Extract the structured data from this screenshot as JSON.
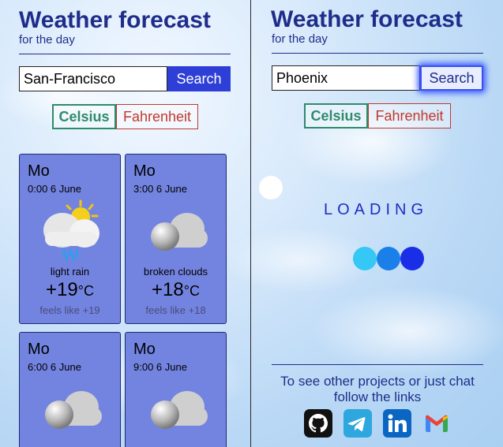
{
  "left": {
    "title": "Weather forecast",
    "subtitle": "for the day",
    "search_value": "San-Francisco",
    "search_button": "Search",
    "unit_celsius": "Celsius",
    "unit_fahrenheit": "Fahrenheit",
    "cards": [
      {
        "day": "Mo",
        "time": "0:00 6 June",
        "description": "light rain",
        "temp": "+19",
        "unit": "°C",
        "feels": "feels like +19",
        "icon": "sun-cloud-rain-icon"
      },
      {
        "day": "Mo",
        "time": "3:00 6 June",
        "description": "broken clouds",
        "temp": "+18",
        "unit": "°C",
        "feels": "feels like +18",
        "icon": "broken-clouds-icon"
      },
      {
        "day": "Mo",
        "time": "6:00 6 June",
        "icon": "broken-clouds-icon"
      },
      {
        "day": "Mo",
        "time": "9:00 6 June",
        "icon": "broken-clouds-icon"
      }
    ]
  },
  "right": {
    "title": "Weather forecast",
    "subtitle": "for the day",
    "search_value": "Phoenix",
    "search_button": "Search",
    "unit_celsius": "Celsius",
    "unit_fahrenheit": "Fahrenheit",
    "loading_text": "LOADING",
    "footer_text": "To see other projects or just chat follow the links",
    "social_icons": [
      "github-icon",
      "telegram-icon",
      "linkedin-icon",
      "gmail-icon"
    ],
    "colors": {
      "dot1": "#35c8f5",
      "dot2": "#1a7fe8",
      "dot3": "#1a2ee8"
    }
  }
}
